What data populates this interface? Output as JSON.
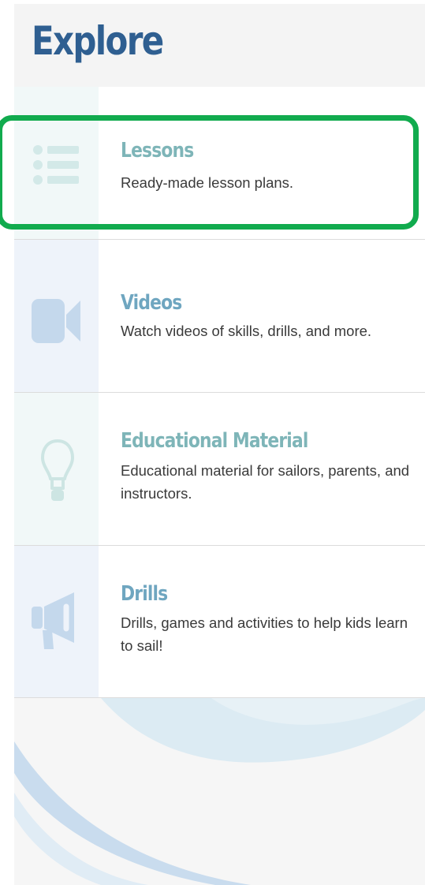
{
  "header": {
    "title": "Explore"
  },
  "items": [
    {
      "title": "Lessons",
      "description": "Ready-made lesson plans.",
      "icon": "list-icon"
    },
    {
      "title": "Videos",
      "description": "Watch videos of skills, drills, and more.",
      "icon": "video-camera-icon"
    },
    {
      "title": "Educational Material",
      "description": "Educational material for sailors, parents, and instructors.",
      "icon": "lightbulb-icon"
    },
    {
      "title": "Drills",
      "description": "Drills, games and activities to help kids learn to sail!",
      "icon": "megaphone-icon"
    }
  ],
  "highlight": {
    "color": "#11ab4e",
    "target": "Lessons"
  },
  "colors": {
    "title": "#2f5f91",
    "item_title": "#7eb5b8",
    "item_title_alt": "#6fa6c0"
  }
}
